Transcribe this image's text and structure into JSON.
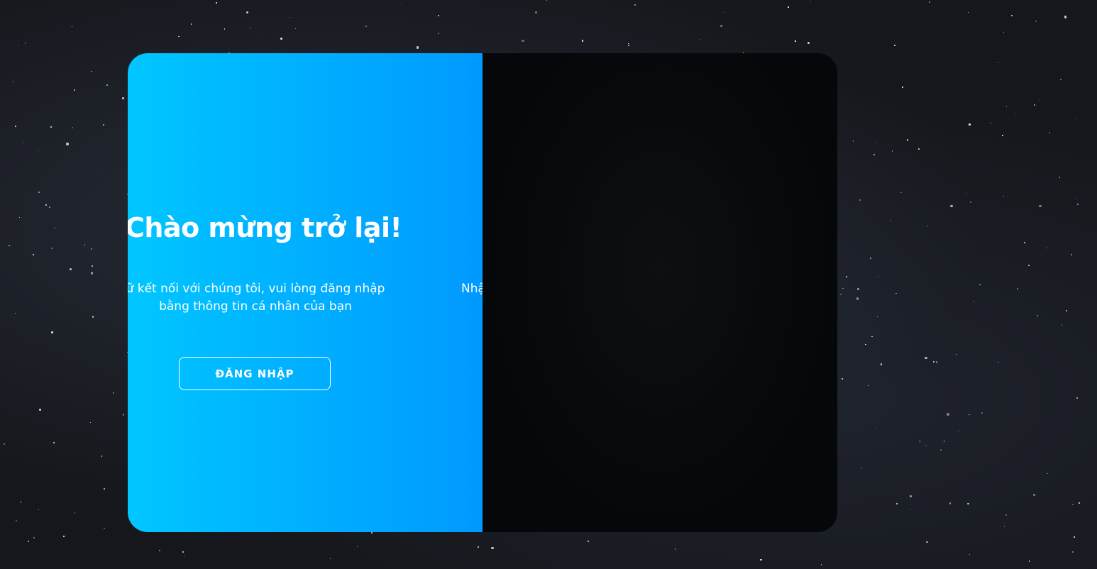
{
  "welcome_panel": {
    "title": "Chào mừng trở lại!",
    "message": "ữ kết nối với chúng tôi, vui lòng đăng nhập bằng thông tin cá nhân của bạn",
    "login_button_label": "ĐĂNG NHẬP"
  },
  "hidden_panel": {
    "clipped_text": "Nhậ"
  },
  "colors": {
    "gradient_start": "#00c6ff",
    "gradient_end": "#0099ff",
    "dark_panel": "#06070a",
    "background": "#15171c"
  }
}
